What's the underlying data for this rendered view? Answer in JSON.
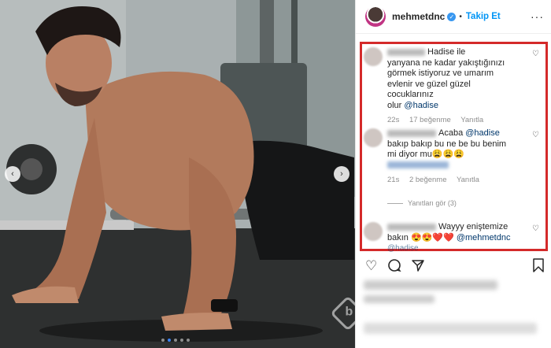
{
  "header": {
    "username": "mehmetdnc",
    "verified_glyph": "✓",
    "separator": "•",
    "follow_label": "Takip Et",
    "more_glyph": "···"
  },
  "carousel": {
    "prev_glyph": "‹",
    "next_glyph": "›",
    "active_index": 1,
    "count": 5
  },
  "comments": [
    {
      "text_lines": [
        "Hadise ile",
        "yanyana ne kadar yakıştığınızı",
        "görmek istiyoruz ve umarım",
        "evlenir ve güzel güzel cocuklarınız",
        "olur"
      ],
      "mention": "@hadise",
      "time": "22s",
      "likes": "17 beğenme",
      "reply": "Yanıtla"
    },
    {
      "pre": "Acaba",
      "mention": "@hadise",
      "text_lines": [
        "bakıp bakıp bu ne be bu benim",
        "mi diyor mu😩😩😩"
      ],
      "time": "21s",
      "likes": "2 beğenme",
      "reply": "Yanıtla"
    },
    {
      "text_lines": [
        "Wayyy eniştemize",
        "bakın 😍😍❤️❤️"
      ],
      "mention": "@mehmetdnc",
      "mention2": "@hadise"
    }
  ],
  "replies_label": "Yanıtları gör (3)",
  "icons": [
    "heart-icon",
    "comment-icon",
    "share-icon",
    "bookmark-icon"
  ],
  "colors": {
    "highlight": "#d42a2a",
    "link": "#00376b",
    "follow": "#0095f6"
  }
}
